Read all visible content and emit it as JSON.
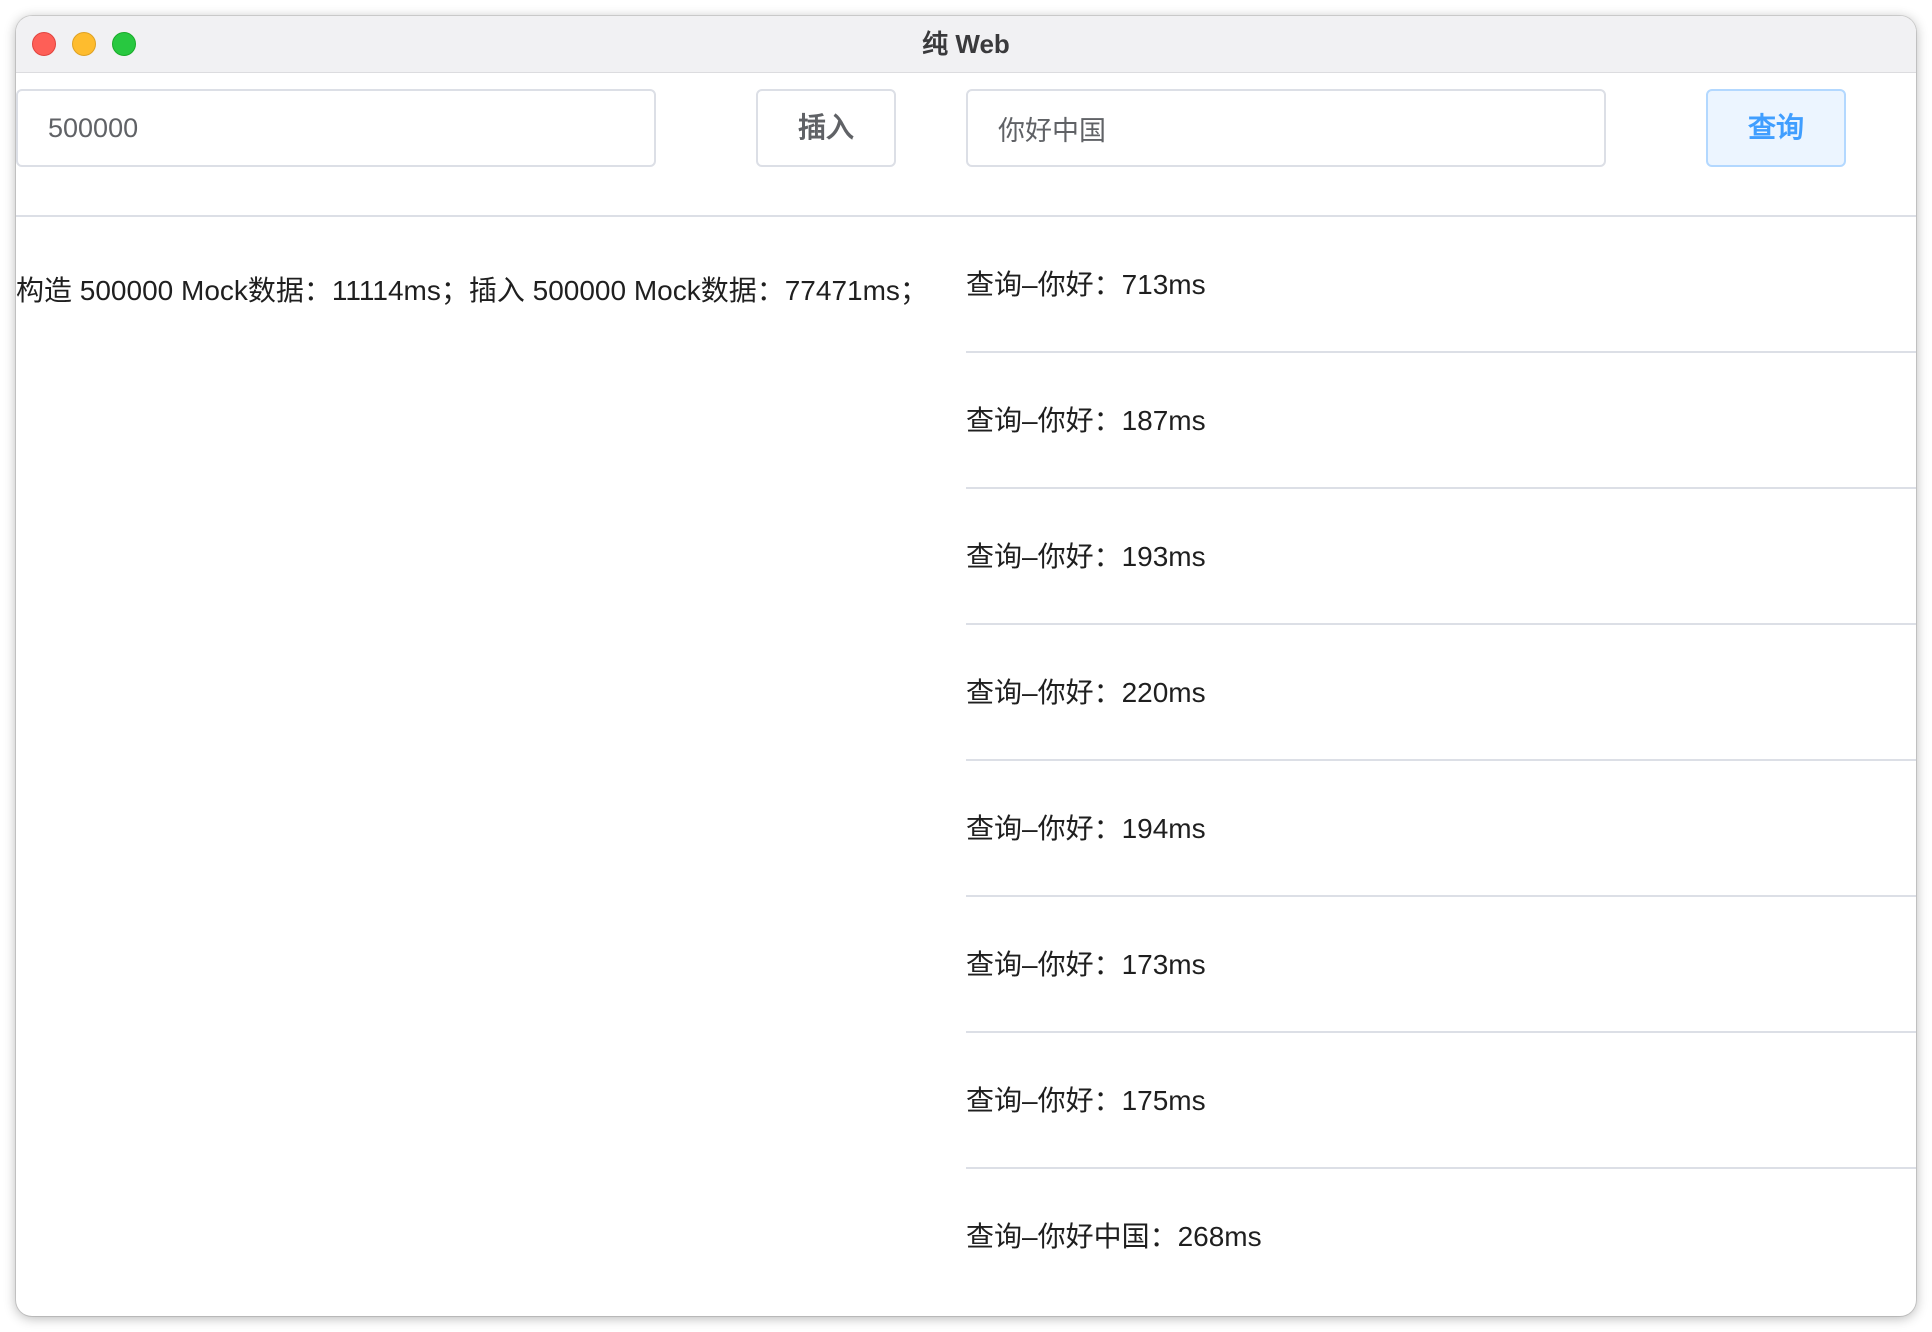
{
  "window": {
    "title": "纯 Web"
  },
  "toolbar": {
    "count_value": "500000",
    "insert_label": "插入",
    "query_value": "你好中国",
    "search_label": "查询"
  },
  "insert_log": "构造 500000 Mock数据：11114ms；插入 500000 Mock数据：77471ms；",
  "query_results": [
    "查询–你好：713ms",
    "查询–你好：187ms",
    "查询–你好：193ms",
    "查询–你好：220ms",
    "查询–你好：194ms",
    "查询–你好：173ms",
    "查询–你好：175ms",
    "查询–你好中国：268ms"
  ],
  "colors": {
    "primary": "#409eff",
    "primary_light_bg": "#ecf5ff",
    "border": "#dcdfe6",
    "text": "#1f1f1f"
  }
}
